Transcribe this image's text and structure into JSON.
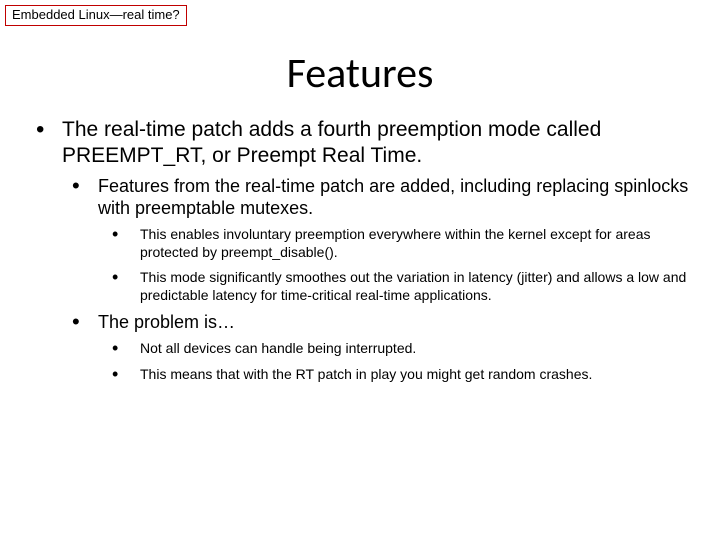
{
  "tag": "Embedded Linux—real time?",
  "title": "Features",
  "bullets": {
    "l1_0": "The real-time patch adds a fourth preemption mode called PREEMPT_RT, or Preempt Real Time.",
    "l2_0": "Features from the real-time patch are added, including replacing spinlocks with preemptable mutexes.",
    "l3_0": "This enables involuntary preemption everywhere within the kernel except for areas protected by preempt_disable().",
    "l3_1": "This mode significantly smoothes out the variation in latency (jitter) and allows a low and predictable latency for time-critical real-time applications.",
    "l2_1": "The problem is…",
    "l3_2": "Not all devices can handle being interrupted.",
    "l3_3": "This means that with the RT patch in play you might get random crashes."
  }
}
